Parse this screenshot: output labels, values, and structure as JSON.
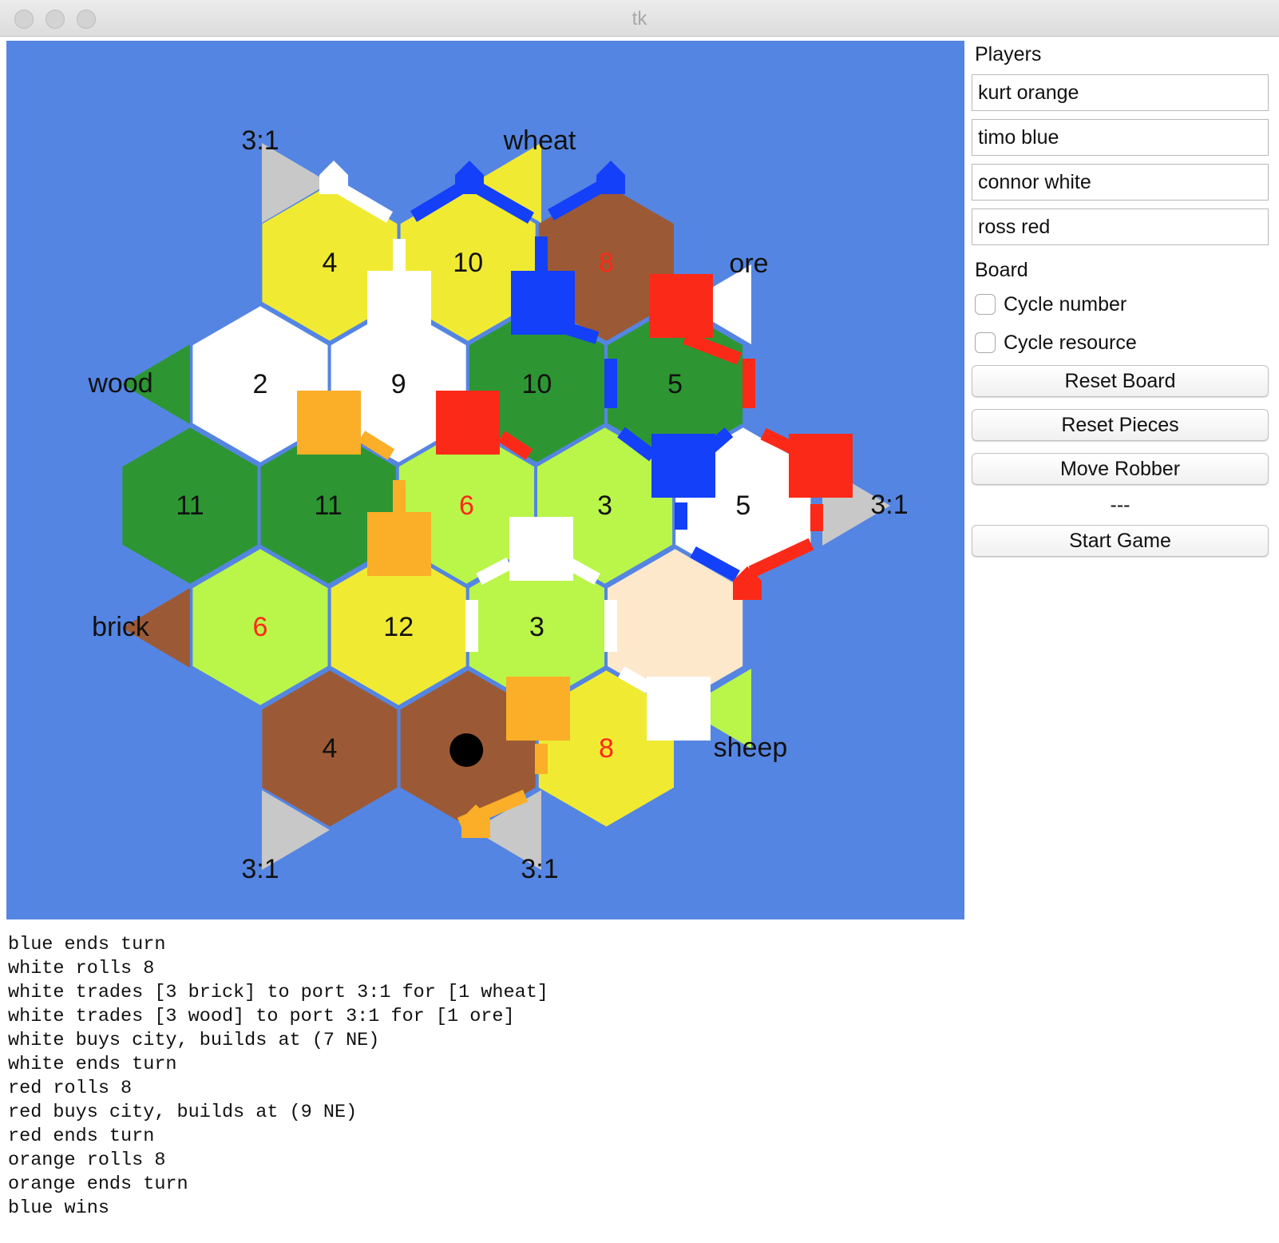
{
  "window": {
    "title": "tk"
  },
  "colors": {
    "ocean": "#5585e2",
    "wheat": "#f0ea33",
    "ore": "#9b5a35",
    "wood": "#2d9632",
    "sheep": "#baf54a",
    "brick": "#9b5a35",
    "desert": "#fde8cc",
    "white_tile": "#f2f2f2",
    "orange": "#fbae27",
    "blue": "#1440fa",
    "red": "#fb2a18",
    "white": "#ffffff",
    "port_generic": "#c8c8c8",
    "hot_number": "#fb2a18"
  },
  "board": {
    "hexes": [
      {
        "r": 0,
        "c": 0,
        "resource": "wheat",
        "number": "4"
      },
      {
        "r": 0,
        "c": 1,
        "resource": "wheat",
        "number": "10"
      },
      {
        "r": 0,
        "c": 2,
        "resource": "ore",
        "number": "8"
      },
      {
        "r": 1,
        "c": 0,
        "resource": "white",
        "number": "2"
      },
      {
        "r": 1,
        "c": 1,
        "resource": "white",
        "number": "9"
      },
      {
        "r": 1,
        "c": 2,
        "resource": "wood",
        "number": "10"
      },
      {
        "r": 1,
        "c": 3,
        "resource": "wood",
        "number": "5"
      },
      {
        "r": 2,
        "c": 0,
        "resource": "wood",
        "number": "11"
      },
      {
        "r": 2,
        "c": 1,
        "resource": "wood",
        "number": "11"
      },
      {
        "r": 2,
        "c": 2,
        "resource": "sheep",
        "number": "6"
      },
      {
        "r": 2,
        "c": 3,
        "resource": "sheep",
        "number": "3"
      },
      {
        "r": 2,
        "c": 4,
        "resource": "white",
        "number": "5"
      },
      {
        "r": 3,
        "c": 0,
        "resource": "sheep",
        "number": "6"
      },
      {
        "r": 3,
        "c": 1,
        "resource": "wheat",
        "number": "12"
      },
      {
        "r": 3,
        "c": 2,
        "resource": "sheep",
        "number": "3"
      },
      {
        "r": 3,
        "c": 3,
        "resource": "desert",
        "number": ""
      },
      {
        "r": 4,
        "c": 0,
        "resource": "ore",
        "number": "4"
      },
      {
        "r": 4,
        "c": 1,
        "resource": "ore",
        "number": "",
        "robber": true
      },
      {
        "r": 4,
        "c": 2,
        "resource": "wheat",
        "number": "8"
      }
    ],
    "ports": [
      {
        "label": "3:1",
        "resource": "port_generic",
        "dir": "right",
        "anchor": [
          -1,
          0
        ]
      },
      {
        "label": "wheat",
        "resource": "wheat",
        "dir": "left",
        "anchor": [
          1,
          -1
        ]
      },
      {
        "label": "ore",
        "resource": "white",
        "dir": "left",
        "anchor": [
          3,
          0
        ]
      },
      {
        "label": "wood",
        "resource": "wood",
        "dir": "left",
        "anchor": [
          0,
          1
        ]
      },
      {
        "label": "3:1",
        "resource": "port_generic",
        "dir": "right",
        "anchor": [
          4,
          2
        ]
      },
      {
        "label": "brick",
        "resource": "brick",
        "dir": "left",
        "anchor": [
          0,
          3
        ]
      },
      {
        "label": "sheep",
        "resource": "sheep",
        "dir": "left",
        "anchor": [
          3,
          4
        ]
      },
      {
        "label": "3:1",
        "resource": "port_generic",
        "dir": "right",
        "anchor": [
          -1,
          4
        ]
      },
      {
        "label": "3:1",
        "resource": "port_generic",
        "dir": "left",
        "anchor": [
          1,
          4
        ]
      }
    ]
  },
  "panel": {
    "players_label": "Players",
    "players": [
      "kurt orange",
      "timo blue",
      "connor white",
      "ross red"
    ],
    "board_label": "Board",
    "cycle_number": "Cycle number",
    "cycle_resource": "Cycle resource",
    "reset_board": "Reset Board",
    "reset_pieces": "Reset Pieces",
    "move_robber": "Move Robber",
    "status": "---",
    "start_game": "Start Game"
  },
  "log": [
    "blue ends turn",
    "white rolls 8",
    "white trades [3 brick] to port 3:1 for [1 wheat]",
    "white trades [3 wood] to port 3:1 for [1 ore]",
    "white buys city, builds at (7 NE)",
    "white ends turn",
    "red rolls 8",
    "red buys city, builds at (9 NE)",
    "red ends turn",
    "orange rolls 8",
    "orange ends turn",
    "blue wins"
  ]
}
